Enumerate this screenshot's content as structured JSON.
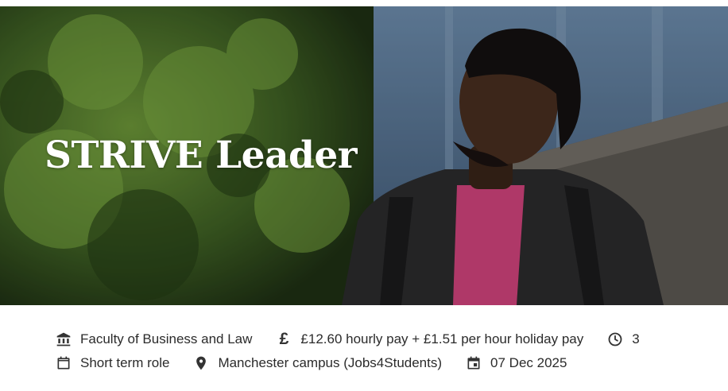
{
  "hero": {
    "title": "STRIVE Leader",
    "image_alt": "Student wearing a leather jacket and pink t-shirt outside a campus building"
  },
  "details": {
    "faculty": {
      "icon": "institution-icon",
      "text": "Faculty of Business and Law"
    },
    "pay": {
      "icon": "pound-icon",
      "text": "£12.60 hourly pay + £1.51 per hour holiday pay"
    },
    "hours": {
      "icon": "clock-icon",
      "text": "3"
    },
    "term": {
      "icon": "calendar-icon",
      "text": "Short term role"
    },
    "location": {
      "icon": "location-pin-icon",
      "text": "Manchester campus (Jobs4Students)"
    },
    "closing_date": {
      "icon": "calendar-event-icon",
      "text": "07 Dec 2025"
    }
  },
  "colors": {
    "title_text": "#ffffff",
    "body_text": "#2b2b2b",
    "shirt_pink": "#d6457f",
    "jacket": "#2c2c2e"
  }
}
